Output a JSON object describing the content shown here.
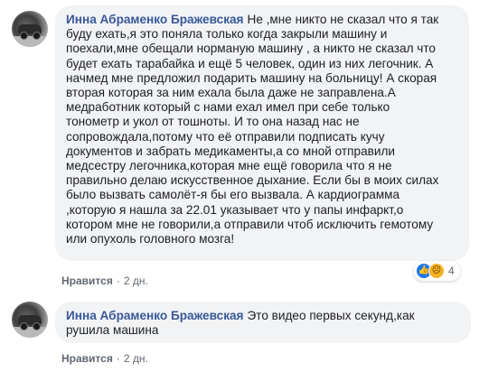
{
  "comments": [
    {
      "author": "Инна Абраменко Бражевская",
      "text": "Не ,мне никто не сказал что я так\nбуду ехать,я это поняла только когда закрыли машину и\nпоехали,мне обещали норманую машину , а никто не сказал что\nбудет ехать тарабайка и ещё 5 человек, один из них легочник. А\nначмед мне предложил подарить машину на больницу! А скорая\nвторая которая за ним ехала была даже не заправлена.А\nмедработник который с нами ехал имел при себе только\nтонометр и укол от тошноты. И то она назад нас не\nсопровождала,потому что её отправили подписать кучу\nдокументов и забрать медикаменты,а со мной отправили\nмедсестру легочника,которая мне ещё говорила что я не\nправильно делаю искусственное дыхание. Если бы в моих силах\nбыло вызвать самолёт-я бы его вызвала. А кардиограмма\n,которую я нашла за 22.01 указывает что у папы инфаркт,о\nкотором мне не говорили,а отправили чтоб исключить гемотому\nили опухоль головного мозга!",
      "like_label": "Нравится",
      "time": "2 дн.",
      "reaction_count": "4",
      "reaction_icons": [
        "like-icon",
        "sad-icon"
      ]
    },
    {
      "author": "Инна Абраменко Бражевская",
      "text": "Это видео первых секунд,как\nрушила машина",
      "like_label": "Нравится",
      "time": "2 дн."
    }
  ],
  "separator": "·",
  "colors": {
    "author": "#385898",
    "bubble": "#f2f3f5",
    "meta": "#606770",
    "like_reaction": "#1877f2",
    "sad_reaction": "#f7b125"
  }
}
